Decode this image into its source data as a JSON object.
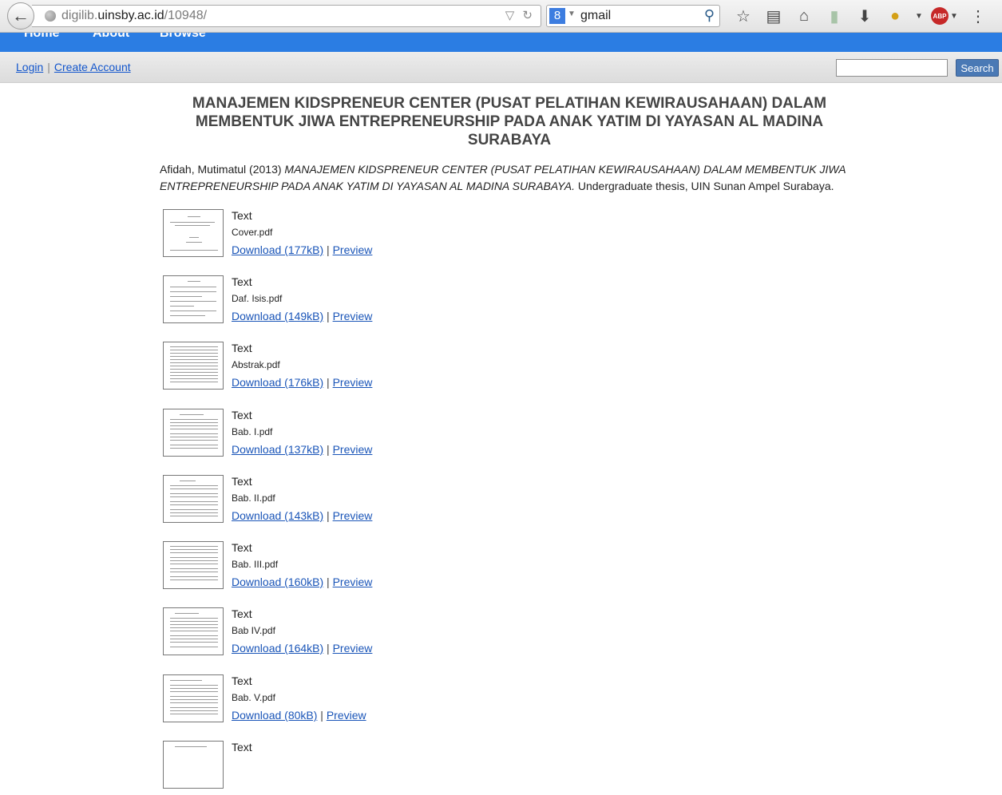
{
  "browser": {
    "url_prefix": "digilib.",
    "url_host": "uinsby.ac.id",
    "url_path": "/10948/",
    "search_term": "gmail"
  },
  "nav": {
    "items": [
      "Home",
      "About",
      "Browse"
    ]
  },
  "account": {
    "login": "Login",
    "create_account": "Create Account",
    "search_button": "Search"
  },
  "record": {
    "title": "MANAJEMEN KIDSPRENEUR CENTER (PUSAT PELATIHAN KEWIRAUSAHAAN) DALAM MEMBENTUK JIWA ENTREPRENEURSHIP PADA ANAK YATIM DI YAYASAN AL MADINA SURABAYA",
    "citation_authors": "Afidah, Mutimatul (2013)",
    "citation_title": "MANAJEMEN KIDSPRENEUR CENTER (PUSAT PELATIHAN KEWIRAUSAHAAN) DALAM MEMBENTUK JIWA ENTREPRENEURSHIP PADA ANAK YATIM DI YAYASAN AL MADINA SURABAYA.",
    "citation_rest": "Undergraduate thesis, UIN Sunan Ampel Surabaya."
  },
  "documents": [
    {
      "type": "Text",
      "file": "Cover.pdf",
      "download": "Download (177kB)",
      "preview": "Preview"
    },
    {
      "type": "Text",
      "file": "Daf. Isis.pdf",
      "download": "Download (149kB)",
      "preview": "Preview"
    },
    {
      "type": "Text",
      "file": "Abstrak.pdf",
      "download": "Download (176kB)",
      "preview": "Preview"
    },
    {
      "type": "Text",
      "file": "Bab. I.pdf",
      "download": "Download (137kB)",
      "preview": "Preview"
    },
    {
      "type": "Text",
      "file": "Bab. II.pdf",
      "download": "Download (143kB)",
      "preview": "Preview"
    },
    {
      "type": "Text",
      "file": "Bab. III.pdf",
      "download": "Download (160kB)",
      "preview": "Preview"
    },
    {
      "type": "Text",
      "file": "Bab IV.pdf",
      "download": "Download (164kB)",
      "preview": "Preview"
    },
    {
      "type": "Text",
      "file": "Bab. V.pdf",
      "download": "Download (80kB)",
      "preview": "Preview"
    },
    {
      "type": "Text"
    }
  ]
}
